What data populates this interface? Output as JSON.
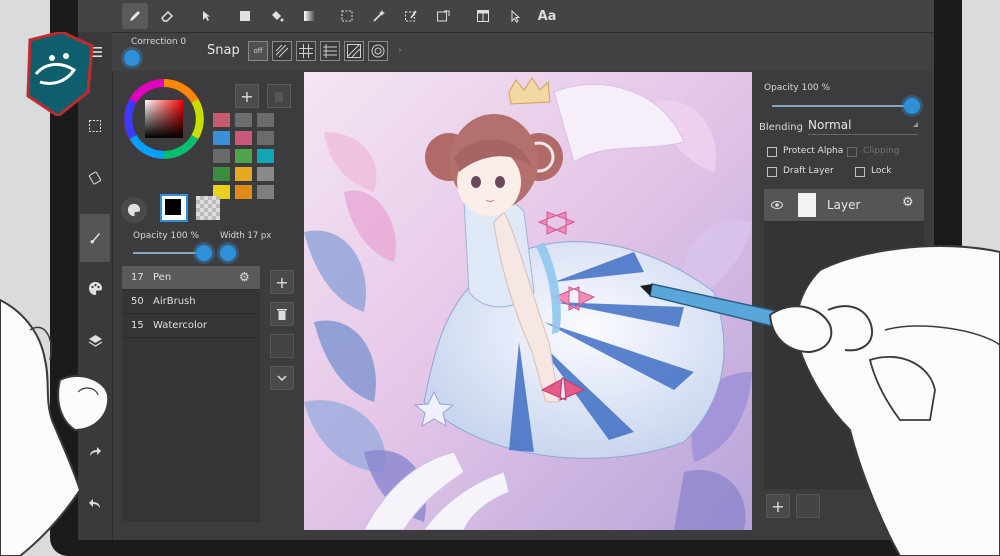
{
  "toolbar": {
    "tools": [
      {
        "icon": "pen-icon",
        "label": ""
      },
      {
        "icon": "eraser-icon",
        "label": ""
      },
      {
        "icon": "move-icon",
        "label": ""
      },
      {
        "icon": "fill-rect-icon",
        "label": ""
      },
      {
        "icon": "bucket-icon",
        "label": ""
      },
      {
        "icon": "gradient-icon",
        "label": ""
      },
      {
        "icon": "select-rect-icon",
        "label": ""
      },
      {
        "icon": "magic-wand-icon",
        "label": ""
      },
      {
        "icon": "select-pen-icon",
        "label": ""
      },
      {
        "icon": "transform-icon",
        "label": ""
      },
      {
        "icon": "panel-icon",
        "label": ""
      },
      {
        "icon": "cursor-icon",
        "label": ""
      },
      {
        "icon": "text-icon",
        "label": "Aa"
      }
    ]
  },
  "subbar": {
    "correction_label": "Correction 0",
    "snap_label": "Snap",
    "snap_off_label": "off"
  },
  "color_panel": {
    "add_symbol": "+",
    "swatches": [
      "#c95a6e",
      "#6e6e6e",
      "#6a6a6a",
      "#3a8fd8",
      "#c75a78",
      "#6b6b6b",
      "#6a6a6a",
      "#4fa34a",
      "#11a6b6",
      "#3b8c40",
      "#e6a81e",
      "#8a8a8a",
      "#e8d21c",
      "#e08a18",
      "#7f7f7f",
      "#c7283a",
      "#667a8c",
      "#d8402e",
      "#d6206a",
      "#cc3366"
    ],
    "primary_color": "#000000",
    "secondary_color": "transparent"
  },
  "brush_sliders": {
    "opacity_label": "Opacity 100 %",
    "width_label": "Width 17 px"
  },
  "brush_list": [
    {
      "size": "17",
      "name": "Pen"
    },
    {
      "size": "50",
      "name": "AirBrush"
    },
    {
      "size": "15",
      "name": "Watercolor"
    }
  ],
  "brush_actions": {
    "add_symbol": "+"
  },
  "layers_panel": {
    "opacity_label": "Opacity 100 %",
    "blending_label": "Blending",
    "blending_value": "Normal",
    "protect_alpha_label": "Protect Alpha",
    "clipping_label": "Clipping",
    "draft_layer_label": "Draft Layer",
    "lock_label": "Lock",
    "layer_name": "Layer",
    "add_symbol": "+"
  },
  "colors": {
    "accent": "#2f8fd8",
    "panel": "#3c3c3e",
    "toolbar": "#444446"
  }
}
